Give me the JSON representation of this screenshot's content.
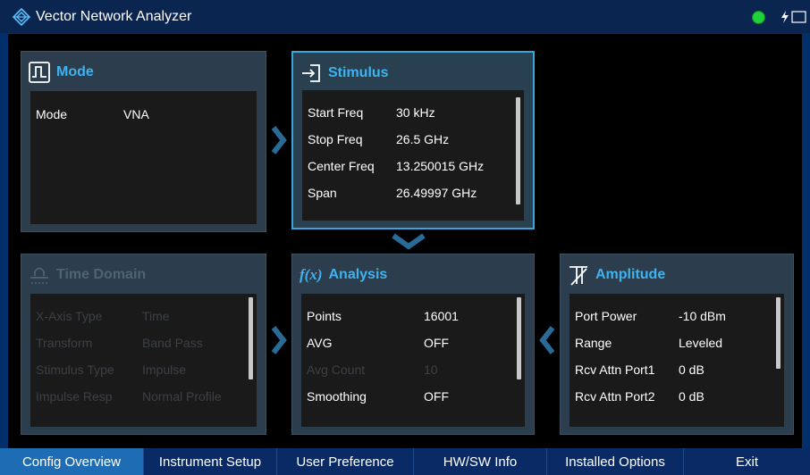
{
  "window": {
    "title": "Vector Network Analyzer"
  },
  "colors": {
    "accent": "#3fb3ef",
    "status_ok": "#1ed23a",
    "tab_active": "#1e6db4"
  },
  "panels": {
    "mode": {
      "title": "Mode",
      "icon": "mode-pulse-icon",
      "rows": [
        {
          "label": "Mode",
          "value": "VNA"
        }
      ]
    },
    "stimulus": {
      "title": "Stimulus",
      "icon": "stimulus-arrow-icon",
      "rows": [
        {
          "label": "Start Freq",
          "value": "30 kHz"
        },
        {
          "label": "Stop Freq",
          "value": "26.5 GHz"
        },
        {
          "label": "Center Freq",
          "value": "13.250015 GHz"
        },
        {
          "label": "Span",
          "value": "26.49997 GHz"
        }
      ]
    },
    "time_domain": {
      "title": "Time Domain",
      "icon": "time-domain-icon",
      "rows": [
        {
          "label": "X-Axis Type",
          "value": "Time"
        },
        {
          "label": "Transform",
          "value": "Band Pass"
        },
        {
          "label": "Stimulus Type",
          "value": "Impulse"
        },
        {
          "label": "Impulse Resp",
          "value": "Normal Profile"
        }
      ]
    },
    "analysis": {
      "title": "Analysis",
      "icon_text": "f(x)",
      "rows": [
        {
          "label": "Points",
          "value": "16001"
        },
        {
          "label": "AVG",
          "value": "OFF"
        },
        {
          "label": "Avg Count",
          "value": "10"
        },
        {
          "label": "Smoothing",
          "value": "OFF"
        }
      ]
    },
    "amplitude": {
      "title": "Amplitude",
      "icon": "amplitude-icon",
      "rows": [
        {
          "label": "Port Power",
          "value": "-10 dBm"
        },
        {
          "label": "Range",
          "value": "Leveled"
        },
        {
          "label": "Rcv Attn Port1",
          "value": "0 dB"
        },
        {
          "label": "Rcv Attn Port2",
          "value": "0 dB"
        }
      ]
    }
  },
  "tabs": [
    {
      "label": "Config Overview",
      "active": true
    },
    {
      "label": "Instrument Setup"
    },
    {
      "label": "User Preference"
    },
    {
      "label": "HW/SW Info"
    },
    {
      "label": "Installed Options"
    },
    {
      "label": "Exit"
    }
  ]
}
